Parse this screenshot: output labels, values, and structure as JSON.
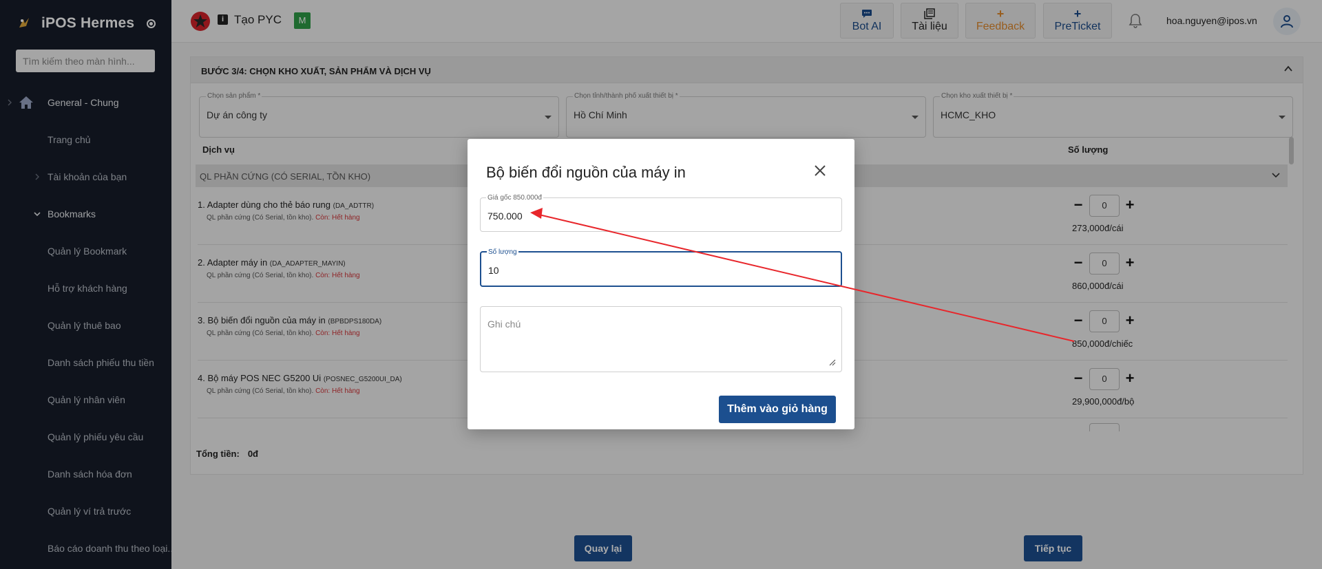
{
  "sidebar": {
    "brand": "iPOS Hermes",
    "search_placeholder": "Tìm kiếm theo màn hình...",
    "items": [
      {
        "label": "General - Chung"
      },
      {
        "label": "Trang chủ"
      },
      {
        "label": "Tài khoản của bạn"
      },
      {
        "label": "Bookmarks"
      },
      {
        "label": "Quản lý Bookmark"
      },
      {
        "label": "Hỗ trợ khách hàng"
      },
      {
        "label": "Quản lý thuê bao"
      },
      {
        "label": "Danh sách phiếu thu tiền"
      },
      {
        "label": "Quản lý nhân viên"
      },
      {
        "label": "Quản lý phiếu yêu cầu"
      },
      {
        "label": "Danh sách hóa đơn"
      },
      {
        "label": "Quản lý ví trả trước"
      },
      {
        "label": "Báo cáo doanh thu theo loại..."
      }
    ]
  },
  "topbar": {
    "title": "Tạo PYC",
    "badge": "M",
    "bot_ai": "Bot AI",
    "docs": "Tài liệu",
    "feedback": "Feedback",
    "preticket": "PreTicket",
    "user": "hoa.nguyen@ipos.vn"
  },
  "step": {
    "title": "BƯỚC 3/4: CHỌN KHO XUẤT, SẢN PHẨM VÀ DỊCH VỤ",
    "product_label": "Chọn sản phẩm *",
    "product_value": "Dự án công ty",
    "city_label": "Chọn tỉnh/thành phố xuất thiết bị *",
    "city_value": "Hồ Chí Minh",
    "warehouse_label": "Chọn kho xuất thiết bị *",
    "warehouse_value": "HCMC_KHO",
    "col_service": "Dịch vụ",
    "col_qty": "Số lượng",
    "group": "QL PHẦN CỨNG (CÓ SERIAL, TỒN KHO)",
    "items": [
      {
        "name": "1. Adapter dùng cho thẻ báo rung",
        "code": "(DA_ADTTR)",
        "sub": "QL phần cứng (Có Serial, tồn kho).",
        "stock": "Còn: Hết hàng",
        "qty": "0",
        "price": "273,000đ/cái"
      },
      {
        "name": "2. Adapter máy in",
        "code": "(DA_ADAPTER_MAYIN)",
        "sub": "QL phần cứng (Có Serial, tồn kho).",
        "stock": "Còn: Hết hàng",
        "qty": "0",
        "price": "860,000đ/cái"
      },
      {
        "name": "3. Bộ biến đổi nguồn của máy in",
        "code": "(BPBDPS180DA)",
        "sub": "QL phần cứng (Có Serial, tồn kho).",
        "stock": "Còn: Hết hàng",
        "qty": "0",
        "price": "850,000đ/chiếc"
      },
      {
        "name": "4. Bộ máy POS NEC G5200 Ui",
        "code": "(POSNEC_G5200UI_DA)",
        "sub": "QL phần cứng (Có Serial, tồn kho).",
        "stock": "Còn: Hết hàng",
        "qty": "0",
        "price": "29,900,000đ/bộ"
      }
    ],
    "total_label": "Tổng tiền:",
    "total_value": "0đ",
    "back": "Quay lại",
    "next": "Tiếp tục"
  },
  "modal": {
    "title": "Bộ biến đổi nguồn của máy in",
    "price_label": "Giá gốc 850.000đ",
    "price_value": "750.000",
    "qty_label": "Số lượng",
    "qty_value": "10",
    "note_placeholder": "Ghi chú",
    "add_to_cart": "Thêm vào giỏ hàng"
  },
  "colors": {
    "primary": "#1c4f8f",
    "sidebar_bg": "#171d2a",
    "stock_red": "#d13438",
    "annotation_red": "#e8262b",
    "feedback_orange": "#e08a2d"
  }
}
